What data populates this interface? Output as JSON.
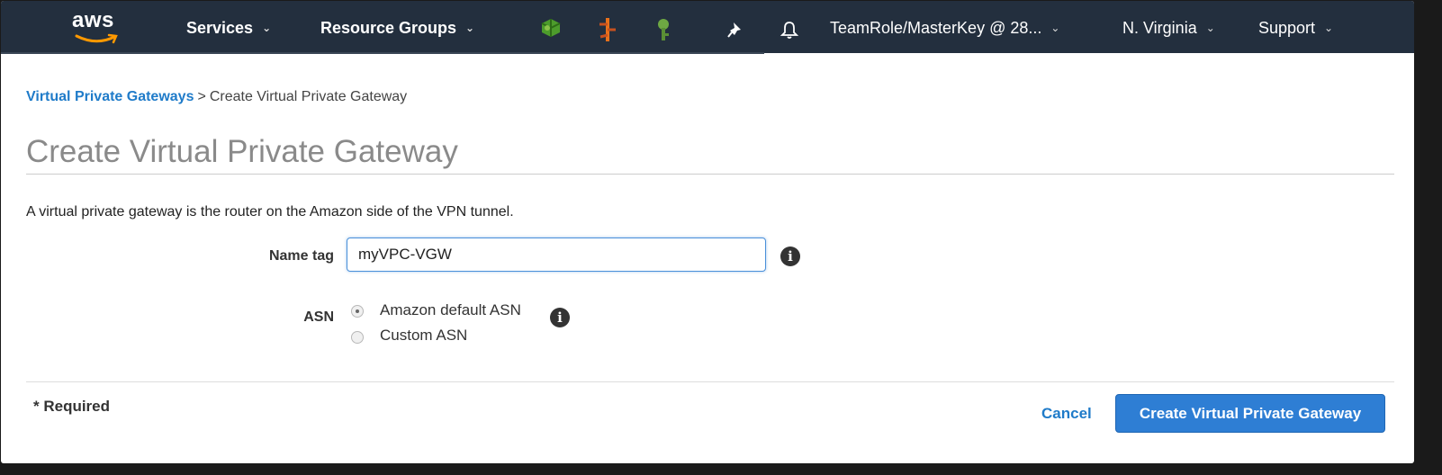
{
  "topbar": {
    "logo_text": "aws",
    "services_label": "Services",
    "resource_groups_label": "Resource Groups",
    "account_label": "TeamRole/MasterKey @ 28...",
    "region_label": "N. Virginia",
    "support_label": "Support",
    "icons": [
      "cloud-service-icon",
      "lambda-service-icon",
      "key-service-icon",
      "pin-icon",
      "bell-icon"
    ]
  },
  "breadcrumb": {
    "parent_label": "Virtual Private Gateways",
    "separator": ">",
    "current_label": "Create Virtual Private Gateway"
  },
  "page": {
    "title": "Create Virtual Private Gateway",
    "description": "A virtual private gateway is the router on the Amazon side of the VPN tunnel."
  },
  "form": {
    "name_tag_label": "Name tag",
    "name_tag_value": "myVPC-VGW",
    "asn_label": "ASN",
    "asn_options": [
      {
        "label": "Amazon default ASN",
        "selected": true
      },
      {
        "label": "Custom ASN",
        "selected": false
      }
    ],
    "info_glyph": "i"
  },
  "footer": {
    "required_note": "* Required",
    "cancel_label": "Cancel",
    "create_label": "Create Virtual Private Gateway"
  },
  "colors": {
    "topbar_bg": "#232f3e",
    "link": "#1f7bc9",
    "primary_button": "#2e7ed4",
    "aws_smile": "#ff9900"
  }
}
